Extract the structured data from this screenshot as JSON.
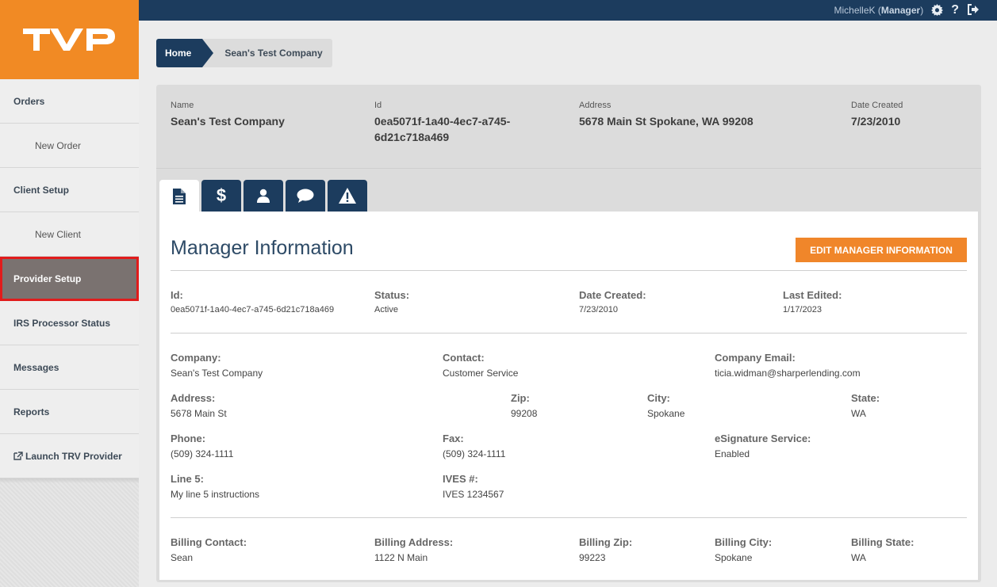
{
  "brand": {
    "logo_text": "TVP",
    "color": "#f18a24"
  },
  "topbar": {
    "user_name": "MichelleK",
    "user_role": "Manager",
    "icons": [
      "gear-icon",
      "help-icon",
      "logout-icon"
    ]
  },
  "sidebar": {
    "items": [
      {
        "label": "Orders",
        "sub": false
      },
      {
        "label": "New Order",
        "sub": true
      },
      {
        "label": "Client Setup",
        "sub": false
      },
      {
        "label": "New Client",
        "sub": true
      },
      {
        "label": "Provider Setup",
        "sub": false,
        "active": true
      },
      {
        "label": "IRS Processor Status",
        "sub": false
      },
      {
        "label": "Messages",
        "sub": false
      },
      {
        "label": "Reports",
        "sub": false
      },
      {
        "label": "Launch TRV Provider",
        "sub": false
      }
    ]
  },
  "breadcrumb": {
    "home": "Home",
    "current": "Sean's Test Company"
  },
  "summary": {
    "name_label": "Name",
    "name": "Sean's Test Company",
    "id_label": "Id",
    "id_line1": "0ea5071f-1a40-4ec7-a745-",
    "id_line2": "6d21c718a469",
    "address_label": "Address",
    "address": "5678 Main St Spokane, WA 99208",
    "date_label": "Date Created",
    "date": "7/23/2010"
  },
  "tabs": [
    {
      "icon": "document-icon",
      "active": true
    },
    {
      "icon": "dollar-icon",
      "active": false
    },
    {
      "icon": "user-icon",
      "active": false
    },
    {
      "icon": "comment-icon",
      "active": false
    },
    {
      "icon": "warning-icon",
      "active": false
    }
  ],
  "manager": {
    "title": "Manager Information",
    "edit_button": "EDIT MANAGER INFORMATION",
    "row1": {
      "id_label": "Id:",
      "id": "0ea5071f-1a40-4ec7-a745-6d21c718a469",
      "status_label": "Status:",
      "status": "Active",
      "created_label": "Date Created:",
      "created": "7/23/2010",
      "edited_label": "Last Edited:",
      "edited": "1/17/2023"
    },
    "company_label": "Company:",
    "company": "Sean's Test Company",
    "contact_label": "Contact:",
    "contact": "Customer Service",
    "email_label": "Company Email:",
    "email": "ticia.widman@sharperlending.com",
    "address_label": "Address:",
    "address": "5678 Main St",
    "zip_label": "Zip:",
    "zip": "99208",
    "city_label": "City:",
    "city": "Spokane",
    "state_label": "State:",
    "state": "WA",
    "phone_label": "Phone:",
    "phone": "(509) 324-1111",
    "fax_label": "Fax:",
    "fax": "(509) 324-1111",
    "esig_label": "eSignature Service:",
    "esig": "Enabled",
    "line5_label": "Line 5:",
    "line5": "My line 5 instructions",
    "ives_label": "IVES #:",
    "ives": "IVES 1234567",
    "billing_contact_label": "Billing Contact:",
    "billing_contact": "Sean",
    "billing_address_label": "Billing Address:",
    "billing_address": "1122 N Main",
    "billing_zip_label": "Billing Zip:",
    "billing_zip": "99223",
    "billing_city_label": "Billing City:",
    "billing_city": "Spokane",
    "billing_state_label": "Billing State:",
    "billing_state": "WA"
  }
}
